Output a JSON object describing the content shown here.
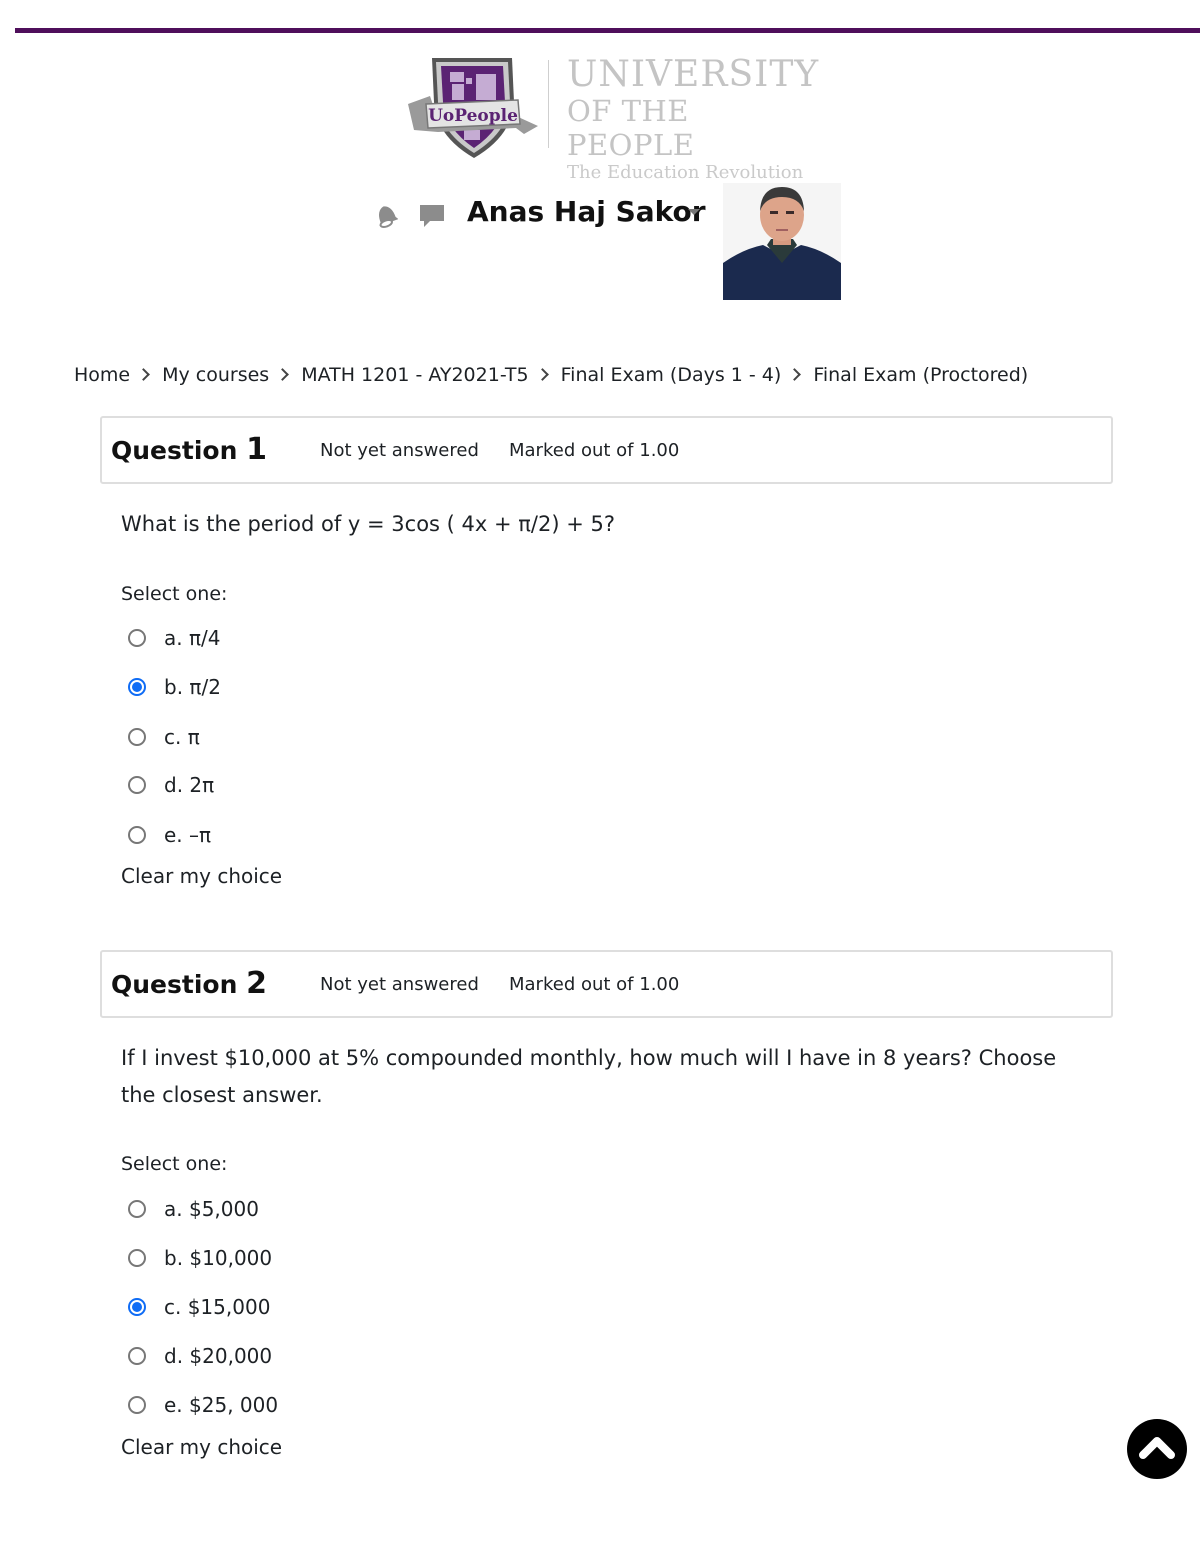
{
  "brand": {
    "accent_color": "#4f0f5b",
    "shield_label": "UoPeople",
    "name_line1": "UNIVERSITY",
    "name_line2": "OF THE PEOPLE",
    "tagline": "The Education Revolution"
  },
  "usernav": {
    "notifications_icon": "bell-icon",
    "messages_icon": "chat-bubble-icon",
    "username": "Anas Haj Sakor",
    "menu_icon": "caret-down-icon"
  },
  "breadcrumb": [
    {
      "label": "Home"
    },
    {
      "label": "My courses"
    },
    {
      "label": "MATH 1201 - AY2021-T5"
    },
    {
      "label": "Final Exam (Days 1 - 4)"
    },
    {
      "label": "Final Exam (Proctored)"
    }
  ],
  "questions": [
    {
      "title_prefix": "Question",
      "number": "1",
      "state": "Not yet answered",
      "grade": "Marked out of 1.00",
      "text": "What is the period of y = 3cos ( 4x + π/2) + 5?",
      "prompt": "Select one:",
      "answers": [
        {
          "label": "a. π/4",
          "checked": false
        },
        {
          "label": "b. π/2",
          "checked": true
        },
        {
          "label": "c. π",
          "checked": false
        },
        {
          "label": "d. 2π",
          "checked": false
        },
        {
          "label": "e. –π",
          "checked": false
        }
      ],
      "clear_label": "Clear my choice"
    },
    {
      "title_prefix": "Question",
      "number": "2",
      "state": "Not yet answered",
      "grade": "Marked out of 1.00",
      "text": "If I invest $10,000 at 5% compounded monthly, how much will I have in 8 years? Choose the closest answer.",
      "prompt": "Select one:",
      "answers": [
        {
          "label": "a. $5,000",
          "checked": false
        },
        {
          "label": "b. $10,000",
          "checked": false
        },
        {
          "label": "c. $15,000",
          "checked": true
        },
        {
          "label": "d. $20,000",
          "checked": false
        },
        {
          "label": "e. $25, 000",
          "checked": false
        }
      ],
      "clear_label": "Clear my choice"
    }
  ],
  "back_to_top_icon": "chevron-up-icon",
  "radio_checked_color": "#0f6cf5"
}
